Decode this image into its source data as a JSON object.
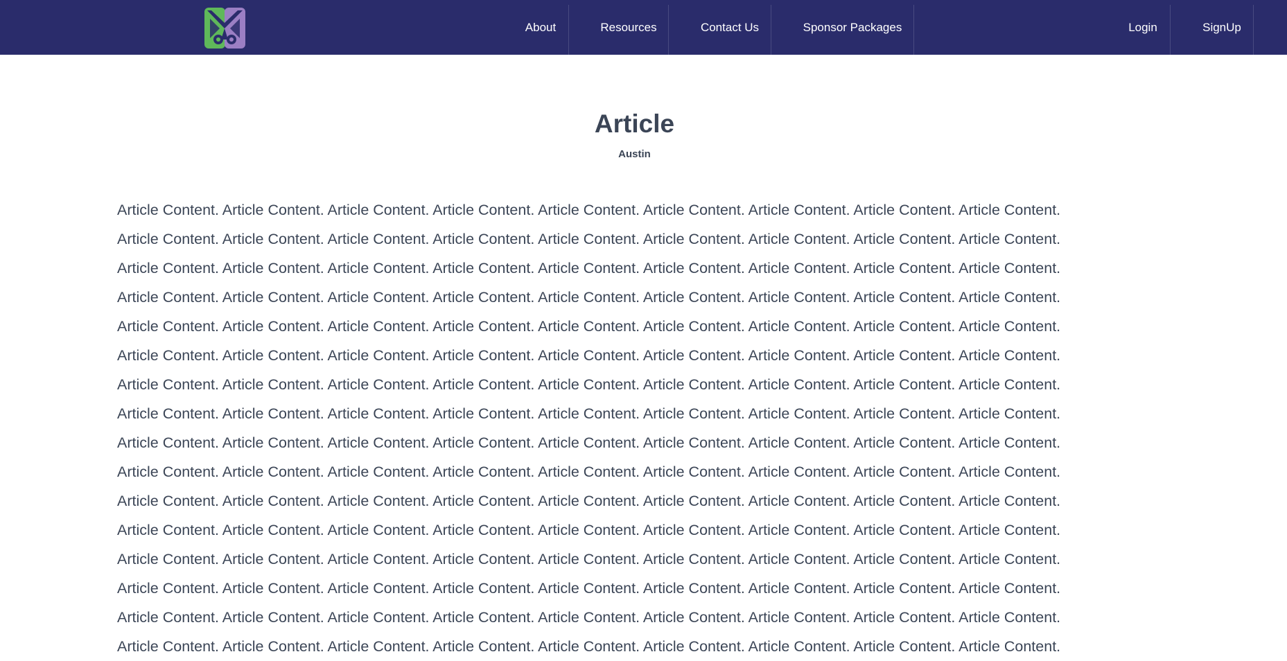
{
  "nav": {
    "items": [
      {
        "label": "About"
      },
      {
        "label": "Resources"
      },
      {
        "label": "Contact Us"
      },
      {
        "label": "Sponsor Packages"
      }
    ],
    "login_label": "Login",
    "signup_label": "SignUp"
  },
  "colors": {
    "navbar_bg": "#2a2c6b",
    "logo_green": "#5fb85a",
    "logo_purple": "#9b7fc4",
    "text": "#3b4556"
  },
  "article": {
    "title": "Article",
    "author": "Austin",
    "content_phrase": "Article Content.",
    "phrases_per_line": 9,
    "visible_lines": 16
  }
}
